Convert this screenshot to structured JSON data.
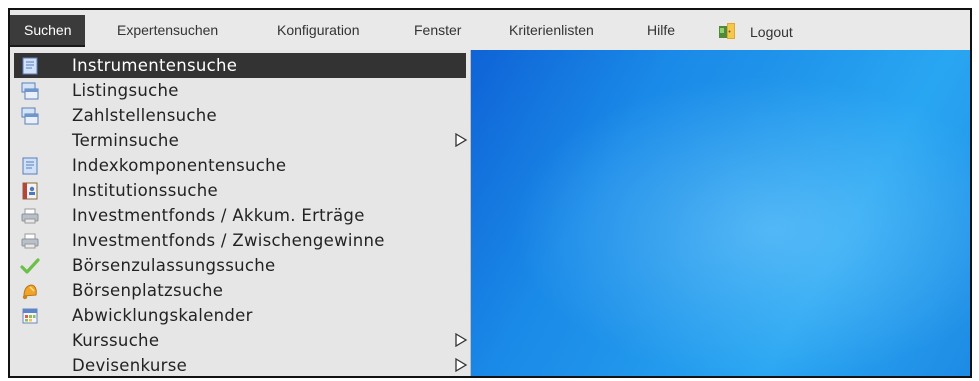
{
  "menubar": {
    "items": [
      {
        "label": "Suchen"
      },
      {
        "label": "Expertensuchen"
      },
      {
        "label": "Konfiguration"
      },
      {
        "label": "Fenster"
      },
      {
        "label": "Kriterienlisten"
      },
      {
        "label": "Hilfe"
      },
      {
        "label": "Logout"
      }
    ]
  },
  "dropdown": {
    "items": [
      {
        "label": "Instrumentensuche",
        "icon": "document-icon",
        "selected": true
      },
      {
        "label": "Listingsuche",
        "icon": "stacked-windows-icon"
      },
      {
        "label": "Zahlstellensuche",
        "icon": "stacked-windows-icon"
      },
      {
        "label": "Terminsuche",
        "submenu": true
      },
      {
        "label": "Indexkomponentensuche",
        "icon": "document-icon"
      },
      {
        "label": "Institutionssuche",
        "icon": "address-book-icon"
      },
      {
        "label": "Investmentfonds / Akkum. Erträge",
        "icon": "printer-icon"
      },
      {
        "label": "Investmentfonds / Zwischengewinne",
        "icon": "printer-icon"
      },
      {
        "label": "Börsenzulassungssuche",
        "icon": "checkmark-icon"
      },
      {
        "label": "Börsenplatzsuche",
        "icon": "bell-icon"
      },
      {
        "label": "Abwicklungskalender",
        "icon": "calendar-icon"
      },
      {
        "label": "Kurssuche",
        "submenu": true
      },
      {
        "label": "Devisenkurse",
        "submenu": true
      }
    ]
  },
  "colors": {
    "menubar_bg": "#e9e9e9",
    "active_bg": "#3b3b3b",
    "selected_item_bg": "#333333",
    "desktop_blue": "#1f93ea"
  }
}
